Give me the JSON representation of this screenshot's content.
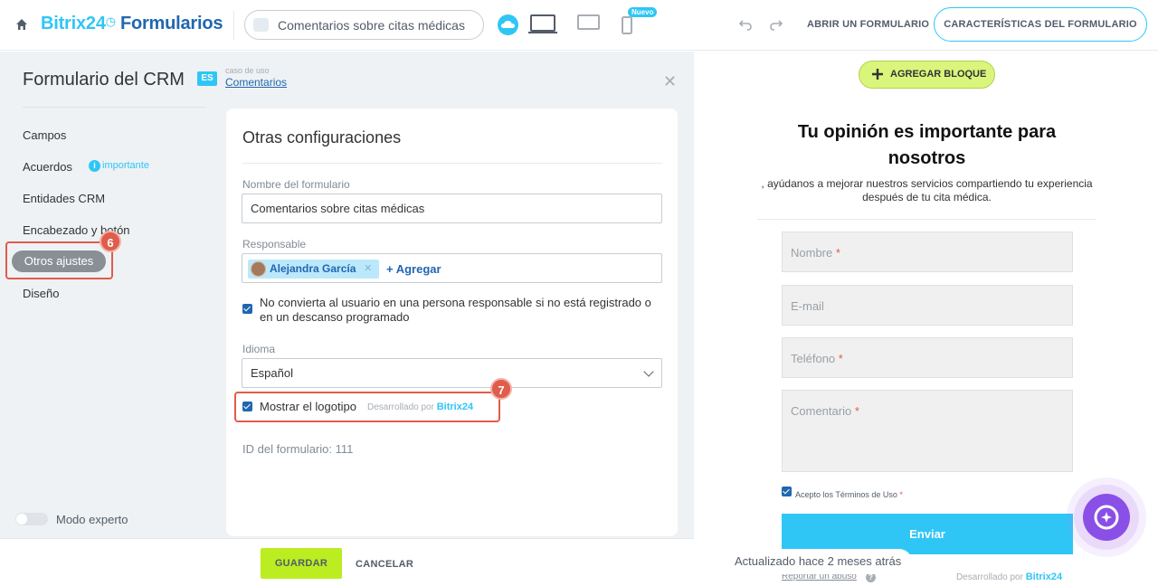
{
  "topbar": {
    "brand_b24": "Bitrix24",
    "brand_form": "Formularios",
    "form_select_value": "Comentarios sobre citas médicas",
    "badge_new": "Nuevo",
    "open_form": "ABRIR UN FORMULARIO",
    "features": "CARACTERÍSTICAS DEL FORMULARIO"
  },
  "left": {
    "title": "Formulario del CRM",
    "usecase_caption": "caso de uso",
    "usecase_link": "Comentarios",
    "menu": {
      "campos": "Campos",
      "acuerdos": "Acuerdos",
      "importante": "importante",
      "entidades": "Entidades CRM",
      "encabezado": "Encabezado y botón",
      "otros": "Otros ajustes",
      "diseno": "Diseño"
    },
    "step6": "6",
    "step7": "7",
    "expert_mode": "Modo experto"
  },
  "card": {
    "title": "Otras configuraciones",
    "name_label": "Nombre del formulario",
    "name_value": "Comentarios sobre citas médicas",
    "responsible_label": "Responsable",
    "responsible_user": "Alejandra García",
    "add_link": "+ Agregar",
    "no_convert_text": "No convierta al usuario en una persona responsable si no está registrado o en un descanso programado",
    "language_label": "Idioma",
    "language_value": "Español",
    "show_logo": "Mostrar el logotipo",
    "powered_prefix": "Desarrollado por",
    "powered_brand": "Bitrix24",
    "form_id": "ID del formulario: 111"
  },
  "bottom": {
    "save": "GUARDAR",
    "cancel": "CANCELAR"
  },
  "preview": {
    "add_block": "AGREGAR BLOQUE",
    "title": "Tu opinión es importante para nosotros",
    "subtitle": ", ayúdanos a mejorar nuestros servicios compartiendo tu experiencia después de tu cita médica.",
    "fields": {
      "name": "Nombre",
      "email": "E-mail",
      "phone": "Teléfono",
      "comment": "Comentario"
    },
    "terms": "Acepto los Términos de Uso",
    "send": "Enviar",
    "report": "Reportar un abuso",
    "powered_prefix": "Desarrollado por",
    "powered_brand": "Bitrix24",
    "updated": "Actualizado hace 2 meses atrás"
  },
  "colors": {
    "accent": "#2fc6f6",
    "brand_dark": "#2067b0",
    "highlight": "#e05c4b",
    "save": "#bbed21"
  }
}
